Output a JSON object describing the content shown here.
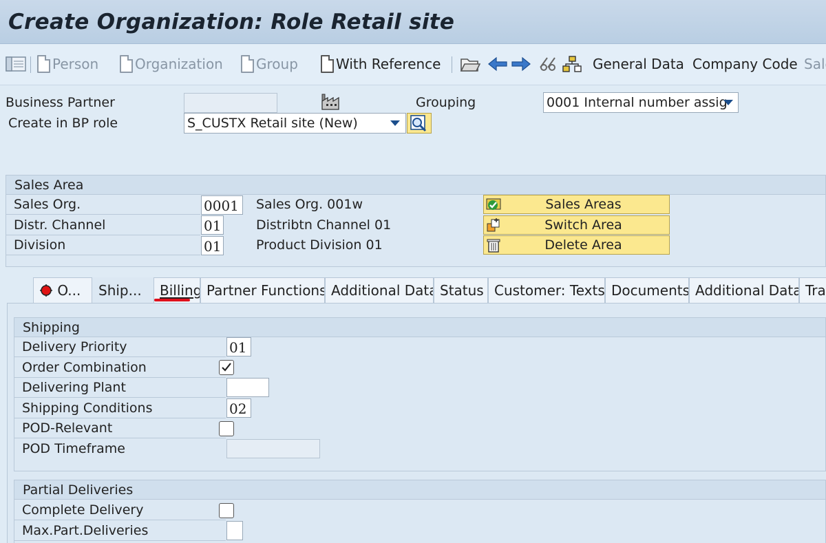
{
  "title": "Create Organization: Role Retail site",
  "toolbar": {
    "person": "Person",
    "organization": "Organization",
    "group": "Group",
    "with_reference": "With Reference",
    "general_data": "General Data",
    "company_code": "Company Code",
    "sales_cut": "Sale"
  },
  "header": {
    "bp_label": "Business Partner",
    "bp_value": "",
    "grouping_label": "Grouping",
    "grouping_value": "0001 Internal number assig",
    "role_label": "Create in BP role",
    "role_value": "S_CUSTX Retail site (New)"
  },
  "sales_area": {
    "title": "Sales Area",
    "rows": [
      {
        "label": "Sales Org.",
        "code": "0001",
        "desc": "Sales Org. 001w"
      },
      {
        "label": "Distr. Channel",
        "code": "01",
        "desc": "Distribtn Channel 01"
      },
      {
        "label": "Division",
        "code": "01",
        "desc": "Product Division 01"
      }
    ],
    "buttons": [
      "Sales Areas",
      "Switch Area",
      "Delete Area"
    ]
  },
  "tabs": [
    "O...",
    "Ship...",
    "Billing",
    "Partner Functions",
    "Additional Data",
    "Status",
    "Customer: Texts",
    "Documents",
    "Additional Data",
    "Tra"
  ],
  "active_tab": "Ship...",
  "highlighted_tab": "Billing",
  "shipping": {
    "title": "Shipping",
    "delivery_priority_label": "Delivery Priority",
    "delivery_priority": "01",
    "order_combination_label": "Order Combination",
    "order_combination": true,
    "delivering_plant_label": "Delivering Plant",
    "delivering_plant": "",
    "shipping_conditions_label": "Shipping Conditions",
    "shipping_conditions": "02",
    "pod_relevant_label": "POD-Relevant",
    "pod_relevant": false,
    "pod_timeframe_label": "POD Timeframe",
    "pod_timeframe": ""
  },
  "partial": {
    "title": "Partial Deliveries",
    "complete_delivery_label": "Complete Delivery",
    "complete_delivery": false,
    "max_part_label": "Max.Part.Deliveries",
    "max_part": ""
  },
  "colors": {
    "title_bg": "#c2d5e8",
    "page_bg": "#dfebf5",
    "button_yellow": "#fbe88f",
    "highlight_underline": "#e0101c"
  }
}
